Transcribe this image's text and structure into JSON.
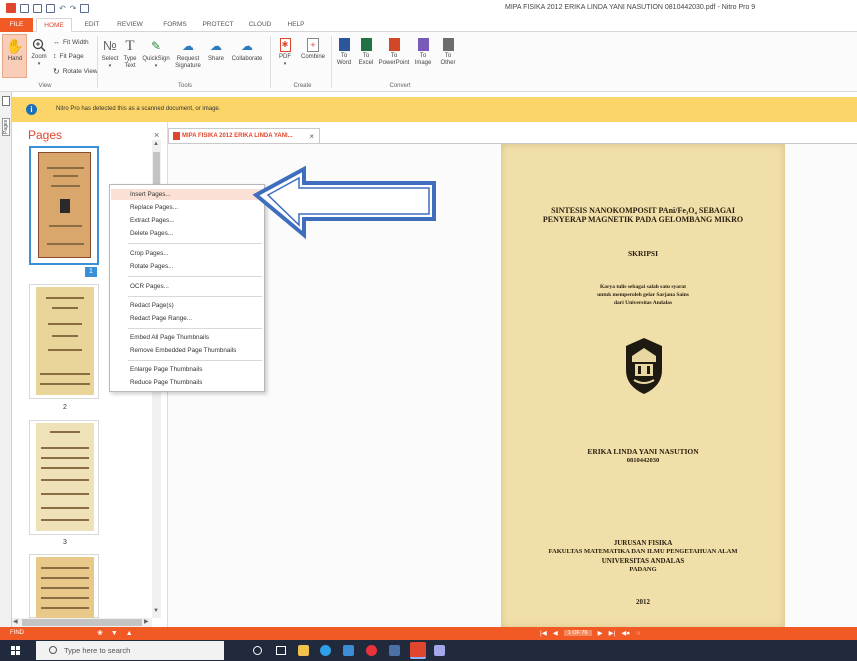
{
  "window": {
    "title": "MIPA FISIKA 2012 ERIKA LINDA YANI NASUTION 0810442030.pdf - Nitro Pro 9"
  },
  "tabs": [
    "FILE",
    "HOME",
    "EDIT",
    "REVIEW",
    "FORMS",
    "PROTECT",
    "CLOUD",
    "HELP"
  ],
  "ribbon": {
    "view": {
      "hand": "Hand",
      "zoom": "Zoom",
      "fit_width": "Fit Width",
      "fit_page": "Fit Page",
      "rotate_view": "Rotate View",
      "label": "View"
    },
    "tools": {
      "select": "Select",
      "type_text_1": "Type",
      "type_text_2": "Text",
      "quicksign": "QuickSign",
      "request_signature_1": "Request",
      "request_signature_2": "Signature",
      "share": "Share",
      "collaborate": "Collaborate",
      "label": "Tools"
    },
    "create": {
      "pdf": "PDF",
      "combine": "Combine",
      "label": "Create"
    },
    "convert": {
      "to_word_1": "To",
      "to_word_2": "Word",
      "to_excel_1": "To",
      "to_excel_2": "Excel",
      "to_powerpoint_1": "To",
      "to_powerpoint_2": "PowerPoint",
      "to_image_1": "To",
      "to_image_2": "Image",
      "to_other_1": "To",
      "to_other_2": "Other",
      "label": "Convert"
    }
  },
  "notification": {
    "message": "Nitro Pro has detected this as a scanned document, or image."
  },
  "side_strip": {
    "pages": "Pages"
  },
  "pages_panel": {
    "title": "Pages",
    "close": "×",
    "thumbnails": [
      "1",
      "2",
      "3"
    ]
  },
  "document_tab": {
    "title": "MIPA FISIKA 2012 ERIKA LINDA YANI...",
    "close": "×"
  },
  "context_menu": {
    "items": [
      "Insert Pages...",
      "Replace Pages...",
      "Extract Pages...",
      "Delete Pages...",
      "Crop Pages...",
      "Rotate Pages...",
      "OCR Pages...",
      "Redact Page(s)",
      "Redact Page Range...",
      "Embed All Page Thumbnails",
      "Remove Embedded Page Thumbnails",
      "Enlarge Page Thumbnails",
      "Reduce Page Thumbnails"
    ]
  },
  "document": {
    "title_line_1": "SINTESIS NANOKOMPOSIT PAni/Fe₃O₄ SEBAGAI",
    "title_line_2": "PENYERAP MAGNETIK PADA GELOMBANG MIKRO",
    "doc_type": "SKRIPSI",
    "purpose_1": "Karya tulis sebagai salah satu syarat",
    "purpose_2": "untuk memperoleh gelar Sarjana Sains",
    "purpose_3": "dari Universitas Andalas",
    "author": "ERIKA LINDA YANI NASUTION",
    "nim": "0810442030",
    "department": "JURUSAN FISIKA",
    "faculty": "FAKULTAS MATEMATIKA DAN ILMU PENGETAHUAN ALAM",
    "university": "UNIVERSITAS ANDALAS",
    "city": "PADANG",
    "year": "2012"
  },
  "statusbar": {
    "find": "FIND",
    "page_indicator": "1 OF 76"
  },
  "taskbar": {
    "search_placeholder": "Type here to search"
  },
  "colors": {
    "accent": "#f15a24",
    "notify": "#fbd567",
    "arrow": "#3f6ebf",
    "taskbar": "#202a3c"
  }
}
